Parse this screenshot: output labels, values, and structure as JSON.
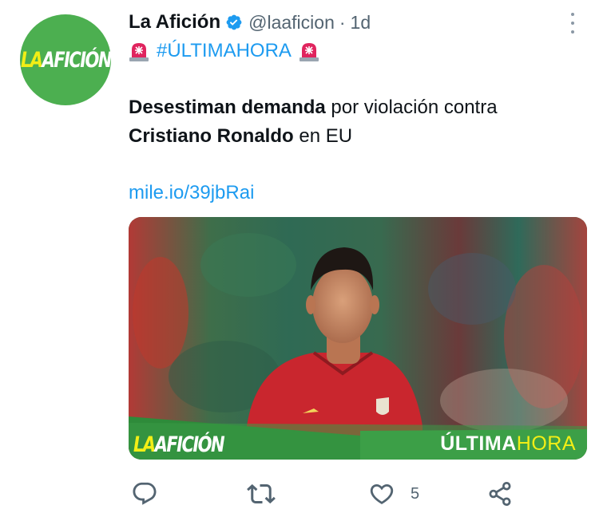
{
  "account": {
    "name": "La Afición",
    "handle": "@laaficion",
    "separator": "·",
    "time": "1d",
    "avatar_logo_a": "LA",
    "avatar_logo_b": "AFICIÓN",
    "verified": true
  },
  "tweet": {
    "hashtag": "#ÚLTIMAHORA",
    "line1_bold": "Desestiman demanda",
    "line1_rest": " por violación contra",
    "line2_bold": "Cristiano Ronaldo",
    "line2_rest": " en EU",
    "link": "mile.io/39jbRai"
  },
  "media": {
    "banner_logo_a": "LA",
    "banner_logo_b": "AFICIÓN",
    "banner_right_a": "ÚLTIMA",
    "banner_right_b": "HORA"
  },
  "actions": {
    "reply_icon": "reply-icon",
    "retweet_icon": "retweet-icon",
    "like_icon": "heart-icon",
    "like_count": "5",
    "share_icon": "share-icon"
  },
  "colors": {
    "brand_green": "#4caf50",
    "brand_yellow": "#f2ee16",
    "link_blue": "#1d9bf0",
    "muted": "#536471"
  }
}
